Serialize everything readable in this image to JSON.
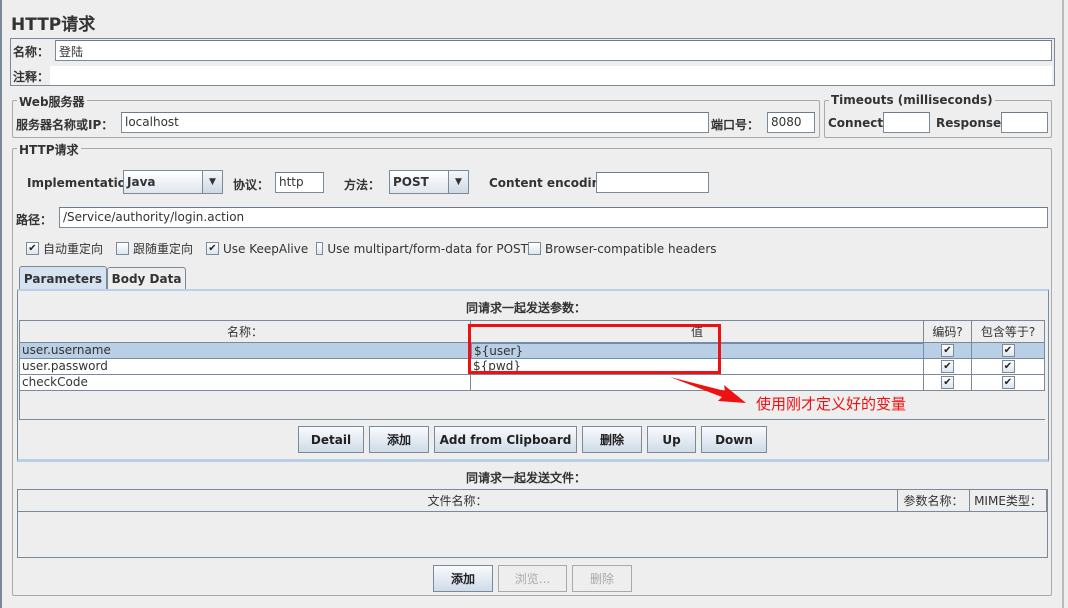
{
  "title": "HTTP请求",
  "name_label": "名称：",
  "name_value": "登陆",
  "comment_label": "注释：",
  "comment_value": "",
  "web_server": {
    "legend": "Web服务器",
    "server_label": "服务器名称或IP：",
    "server_value": "localhost",
    "port_label": "端口号：",
    "port_value": "8080"
  },
  "timeouts": {
    "legend": "Timeouts (milliseconds)",
    "connect_label": "Connect:",
    "connect_value": "",
    "response_label": "Response:",
    "response_value": ""
  },
  "http_request": {
    "legend": "HTTP请求",
    "implementation_label": "Implementation:",
    "implementation_value": "Java",
    "protocol_label": "协议：",
    "protocol_value": "http",
    "method_label": "方法：",
    "method_value": "POST",
    "encoding_label": "Content encoding:",
    "encoding_value": "",
    "path_label": "路径：",
    "path_value": "/Service/authority/login.action",
    "checkboxes": [
      {
        "label": "自动重定向",
        "checked": true
      },
      {
        "label": "跟随重定向",
        "checked": false
      },
      {
        "label": "Use KeepAlive",
        "checked": true
      },
      {
        "label": "Use multipart/form-data for POST",
        "checked": false
      },
      {
        "label": "Browser-compatible headers",
        "checked": false
      }
    ]
  },
  "tabs": [
    {
      "label": "Parameters",
      "active": true
    },
    {
      "label": "Body Data",
      "active": false
    }
  ],
  "params": {
    "heading": "同请求一起发送参数：",
    "columns": [
      "名称：",
      "值",
      "编码?",
      "包含等于?"
    ],
    "rows": [
      {
        "name": "user.username",
        "value": "${user}",
        "encode": true,
        "include_equals": true,
        "selected": true
      },
      {
        "name": "user.password",
        "value": "${pwd}",
        "encode": true,
        "include_equals": true,
        "selected": false
      },
      {
        "name": "checkCode",
        "value": "",
        "encode": true,
        "include_equals": true,
        "selected": false
      }
    ],
    "buttons": [
      "Detail",
      "添加",
      "Add from Clipboard",
      "删除",
      "Up",
      "Down"
    ]
  },
  "annotation": {
    "text": "使用刚才定义好的变量",
    "color": "#ff0000"
  },
  "files": {
    "heading": "同请求一起发送文件：",
    "columns": [
      "文件名称：",
      "参数名称：",
      "MIME类型："
    ],
    "buttons": [
      {
        "label": "添加",
        "enabled": true
      },
      {
        "label": "浏览...",
        "enabled": false
      },
      {
        "label": "删除",
        "enabled": false
      }
    ]
  },
  "check_glyph": "✔"
}
